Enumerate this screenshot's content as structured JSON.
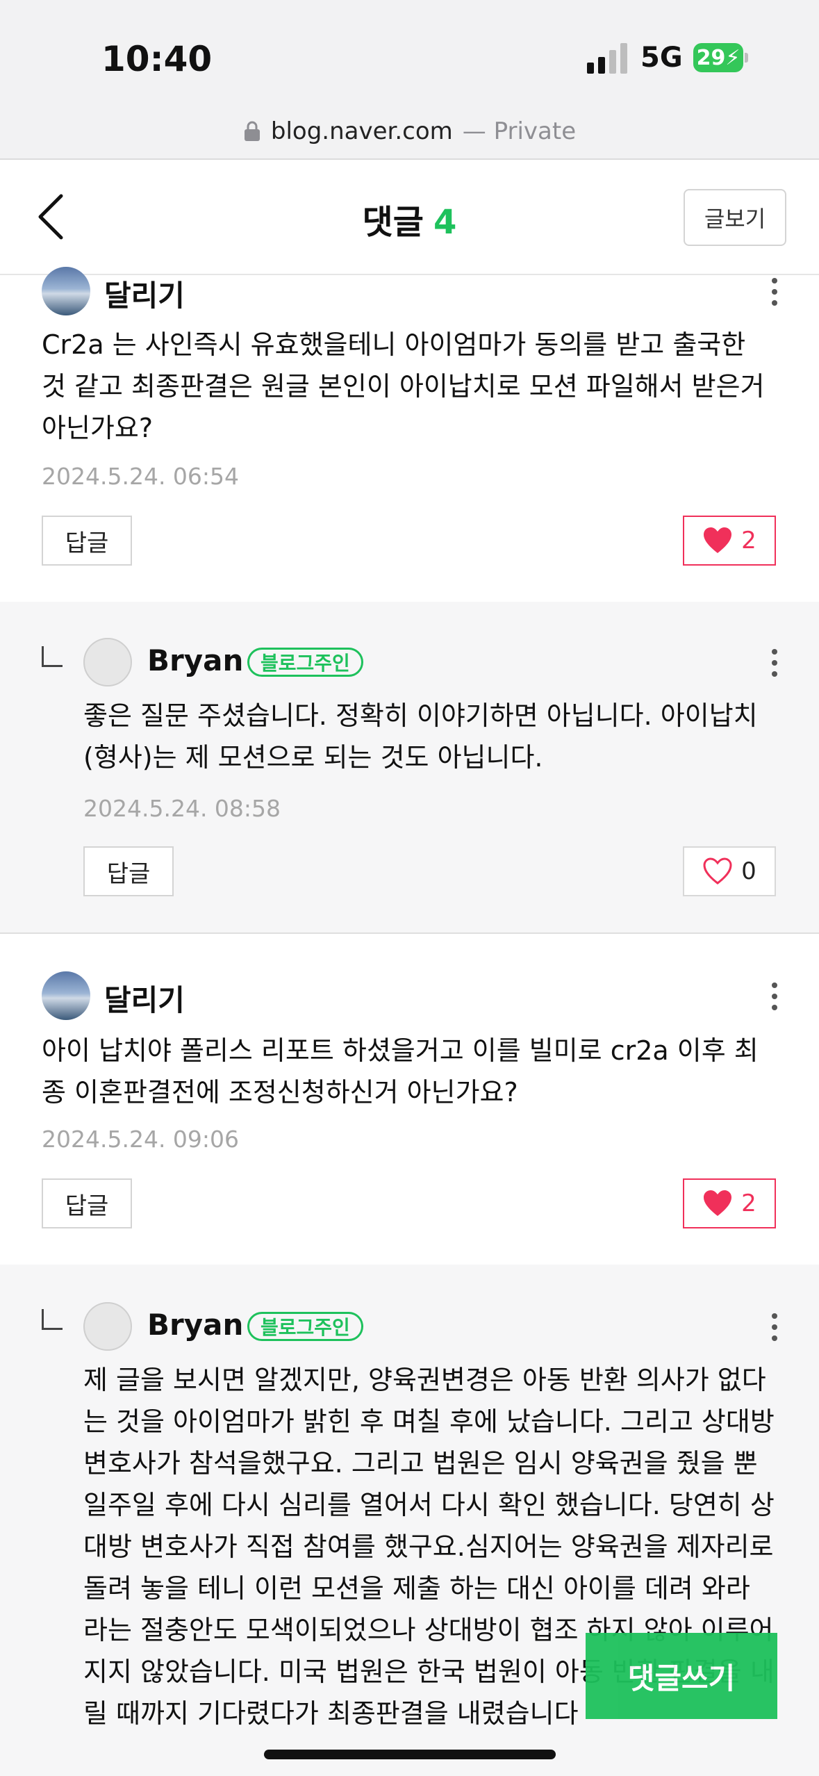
{
  "status": {
    "time": "10:40",
    "network": "5G",
    "battery": "29"
  },
  "browser": {
    "domain": "blog.naver.com",
    "suffix": "— Private"
  },
  "header": {
    "title": "댓글",
    "count": "4",
    "view_post": "글보기"
  },
  "comments": [
    {
      "name": "달리기",
      "text": "Cr2a 는 사인즉시 유효했을테니 아이엄마가 동의를 받고 출국한 것 같고 최종판결은 원글 본인이 아이납치로 모션 파일해서 받은거 아닌가요?",
      "date": "2024.5.24. 06:54",
      "reply": "답글",
      "likes": "2",
      "liked": true
    },
    {
      "name": "Bryan",
      "badge": "블로그주인",
      "text": "좋은 질문 주셨습니다. 정확히 이야기하면 아닙니다. 아이납치 (형사)는 제 모션으로 되는 것도 아닙니다.",
      "date": "2024.5.24. 08:58",
      "reply": "답글",
      "likes": "0",
      "liked": false
    },
    {
      "name": "달리기",
      "text": "아이 납치야 폴리스 리포트 하셨을거고 이를 빌미로 cr2a 이후 최종 이혼판결전에 조정신청하신거 아닌가요?",
      "date": "2024.5.24. 09:06",
      "reply": "답글",
      "likes": "2",
      "liked": true
    },
    {
      "name": "Bryan",
      "badge": "블로그주인",
      "text": "제 글을 보시면 알겠지만, 양육권변경은 아동 반환 의사가 없다는 것을 아이엄마가 밝힌 후 며칠 후에 났습니다. 그리고 상대방 변호사가 참석을했구요. 그리고 법원은 임시 양육권을 줬을 뿐 일주일 후에 다시 심리를 열어서 다시 확인 했습니다. 당연히 상대방 변호사가 직접 참여를 했구요.심지어는 양육권을 제자리로 돌려 놓을 테니 이런 모션을 제출 하는 대신 아이를 데려 와라 라는 절충안도 모색이되었으나 상대방이 협조 하지 않아 이루어지지 않았습니다. 미국 법원은 한국 법원이 아동 반환 판결을 내릴 때까지 기다렸다가 최종판결을 내렸습니다"
    }
  ],
  "write_button": "댓글쓰기",
  "colors": {
    "accent": "#1ec15c",
    "like": "#f0305a"
  }
}
